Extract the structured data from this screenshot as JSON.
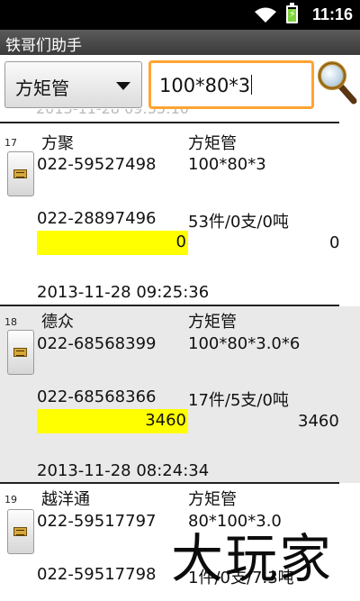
{
  "status_bar": {
    "time": "11:16",
    "battery_color": "#7ed43b",
    "wifi_icon": "wifi-icon",
    "battery_icon": "battery-charging-icon"
  },
  "app": {
    "title": "铁哥们助手"
  },
  "search": {
    "category": "方矩管",
    "query": "100*80*3",
    "accent_color": "#ffa431",
    "button_icon": "magnifier-icon"
  },
  "list": {
    "faded_top_text": "2013-11-28 09:55:10",
    "items": [
      {
        "index": "17",
        "company": "方聚",
        "product": "方矩管",
        "phone1": "022-59527498",
        "spec": "100*80*3",
        "phone2": "022-28897496",
        "stock": "53件/0支/0吨",
        "highlight_value": "0",
        "value": "0",
        "timestamp": "2013-11-28  09:25:36"
      },
      {
        "index": "18",
        "company": "德众",
        "product": "方矩管",
        "phone1": "022-68568399",
        "spec": "100*80*3.0*6",
        "phone2": "022-68568366",
        "stock": "17件/5支/0吨",
        "highlight_value": "3460",
        "value": "3460",
        "timestamp": "2013-11-28  08:24:34"
      },
      {
        "index": "19",
        "company": "越洋通",
        "product": "方矩管",
        "phone1": "022-59517797",
        "spec": "80*100*3.0",
        "phone2": "022-59517798",
        "stock": "1件/0支/7.3吨"
      }
    ],
    "highlight_color": "#ffff00"
  },
  "watermark": "大玩家"
}
